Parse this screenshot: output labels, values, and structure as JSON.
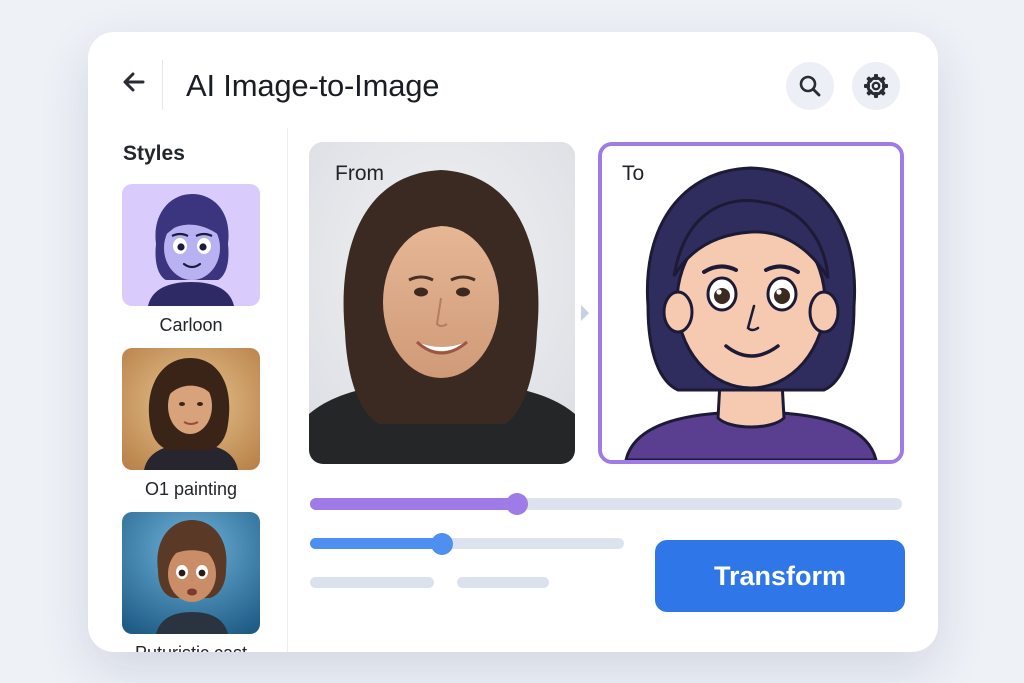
{
  "app": {
    "title": "AI Image-to-Image",
    "back_icon": "arrow-left-icon",
    "search_icon": "search-icon",
    "settings_icon": "gear-icon"
  },
  "sidebar": {
    "title": "Styles",
    "items": [
      {
        "label": "Carloon",
        "icon": "cartoon-style-thumbnail"
      },
      {
        "label": "O1 painting",
        "icon": "oil-painting-style-thumbnail"
      },
      {
        "label": "Puturistic cast",
        "icon": "3d-character-style-thumbnail"
      }
    ]
  },
  "main": {
    "from_label": "From",
    "to_label": "To",
    "sliders": [
      {
        "fraction": 0.35,
        "color": "#9e7be6"
      },
      {
        "fraction": 0.42,
        "color": "#4f8ff2"
      }
    ],
    "transform_label": "Transform"
  },
  "colors": {
    "accent_purple": "#9e7be6",
    "accent_blue": "#2f77e8",
    "background": "#eef1f6"
  }
}
